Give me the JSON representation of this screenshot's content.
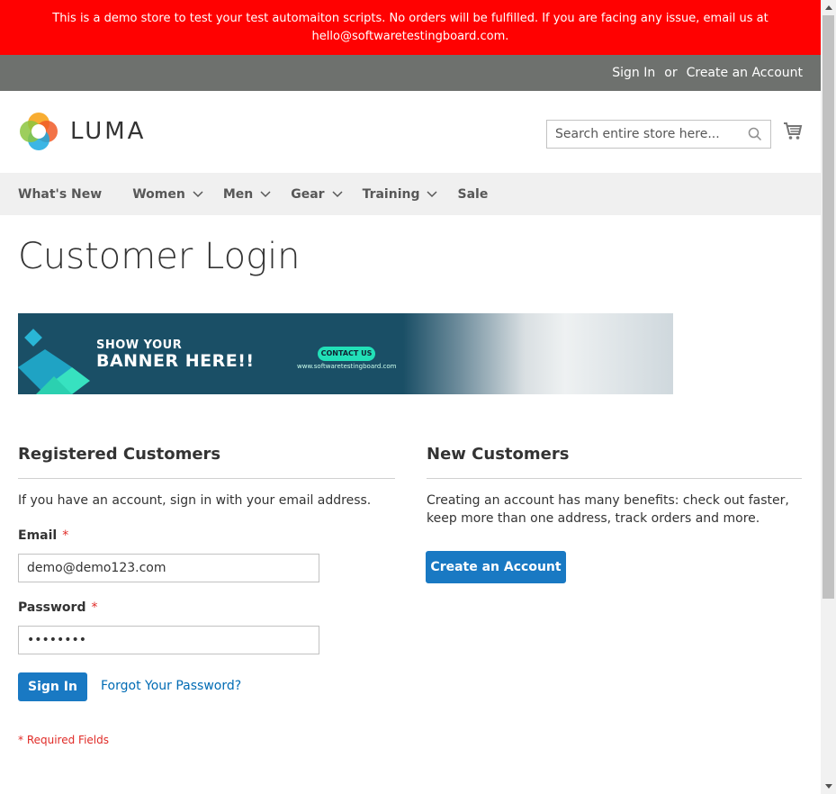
{
  "notice": {
    "line1": "This is a demo store to test your test automaiton scripts. No orders will be fulfilled. If you are facing any issue, email us at",
    "line2": "hello@softwaretestingboard.com."
  },
  "toplinks": {
    "signin": "Sign In",
    "or": "or",
    "create": "Create an Account"
  },
  "header": {
    "logo_text": "LUMA",
    "search_placeholder": "Search entire store here..."
  },
  "nav": {
    "items": [
      {
        "label": "What's New"
      },
      {
        "label": "Women"
      },
      {
        "label": "Men"
      },
      {
        "label": "Gear"
      },
      {
        "label": "Training"
      },
      {
        "label": "Sale"
      }
    ]
  },
  "page": {
    "title": "Customer Login"
  },
  "banner": {
    "show": "SHOW YOUR",
    "here": "BANNER HERE!!",
    "cta": "CONTACT US",
    "url": "www.softwaretestingboard.com"
  },
  "registered": {
    "heading": "Registered Customers",
    "intro": "If you have an account, sign in with your email address.",
    "email_label": "Email",
    "email_value": "demo@demo123.com",
    "password_label": "Password",
    "password_value": "••••••••",
    "required_marker": "*",
    "signin_button": "Sign In",
    "forgot_link": "Forgot Your Password?",
    "required_note": "* Required Fields"
  },
  "new_customers": {
    "heading": "New Customers",
    "intro": "Creating an account has many benefits: check out faster, keep more than one address, track orders and more.",
    "create_button": "Create an Account"
  },
  "colors": {
    "notice": "#ff0101",
    "toplinks": "#6e716e",
    "primary": "#1979c3",
    "required": "#e02b27"
  }
}
